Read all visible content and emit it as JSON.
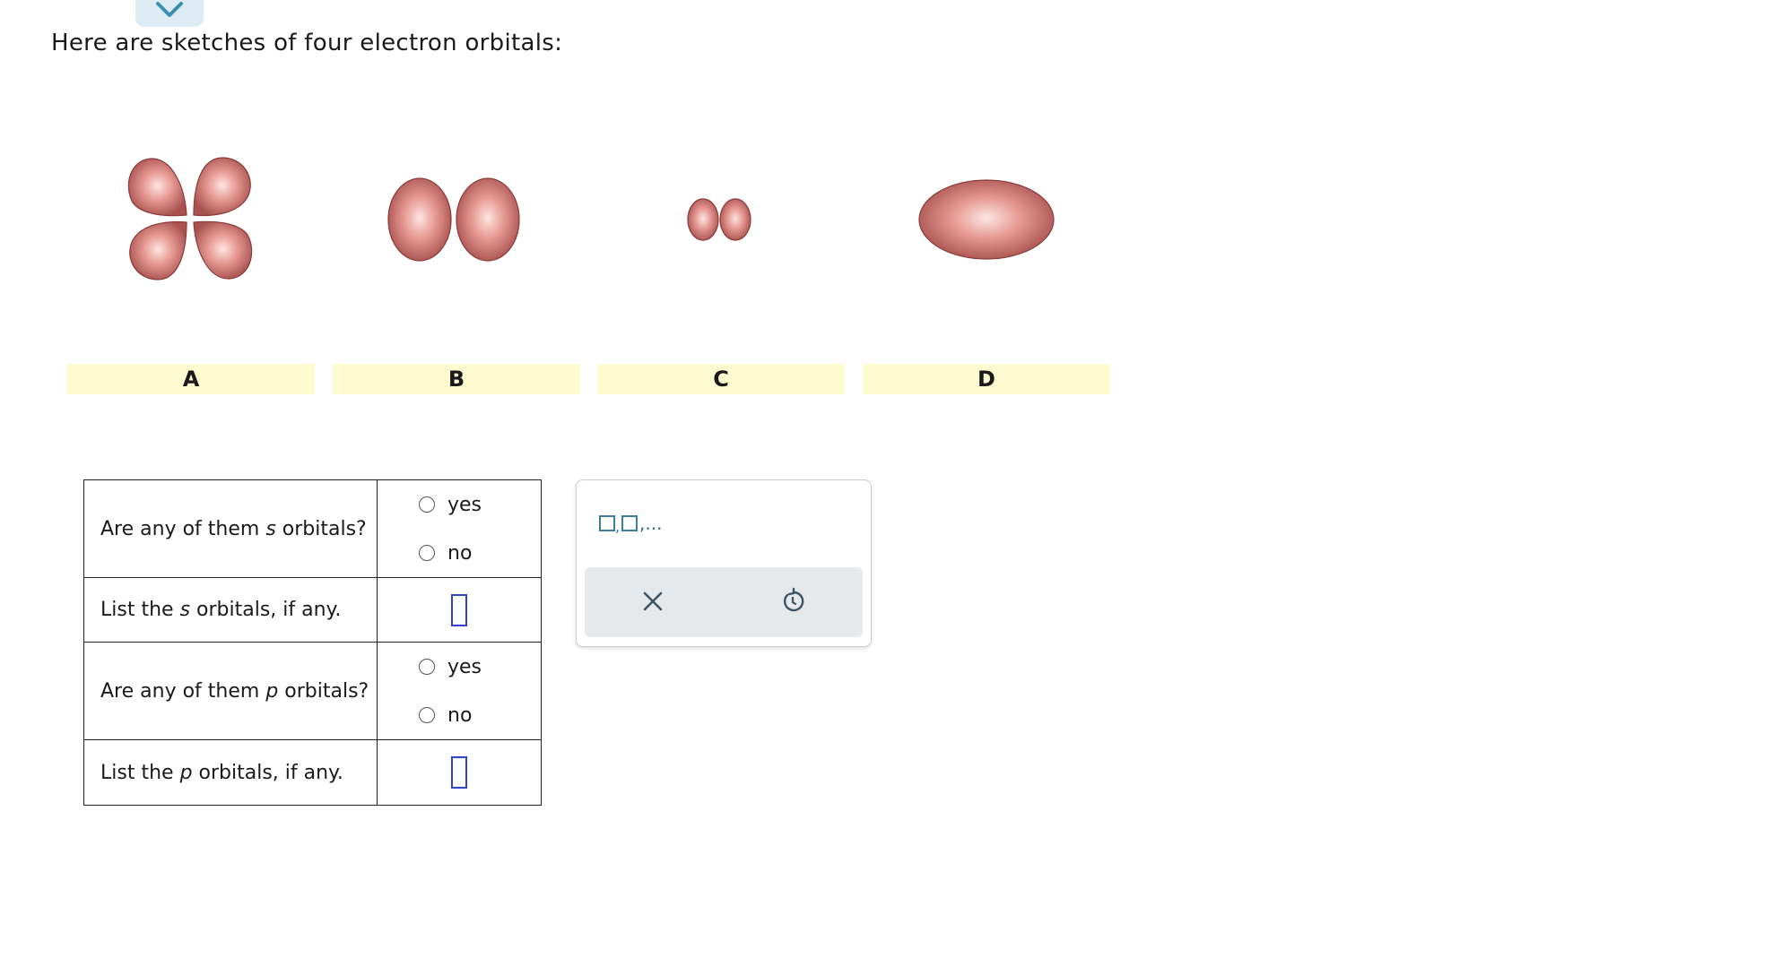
{
  "prompt": "Here are sketches of four electron orbitals:",
  "orbital_labels": [
    "A",
    "B",
    "C",
    "D"
  ],
  "questions": [
    {
      "pre": "Are any of them ",
      "italic": "s",
      "post": " orbitals?",
      "options": [
        "yes",
        "no"
      ]
    },
    {
      "pre": "List the ",
      "italic": "s",
      "post": " orbitals, if any."
    },
    {
      "pre": "Are any of them ",
      "italic": "p",
      "post": " orbitals?",
      "options": [
        "yes",
        "no"
      ]
    },
    {
      "pre": "List the ",
      "italic": "p",
      "post": " orbitals, if any."
    }
  ],
  "toolbox": {
    "sequence_suffix": ",..."
  },
  "colors": {
    "orbital": "#c8706f",
    "label_bg": "#fffbd0",
    "accent": "#3a7ea0",
    "input_border": "#3344cc"
  }
}
